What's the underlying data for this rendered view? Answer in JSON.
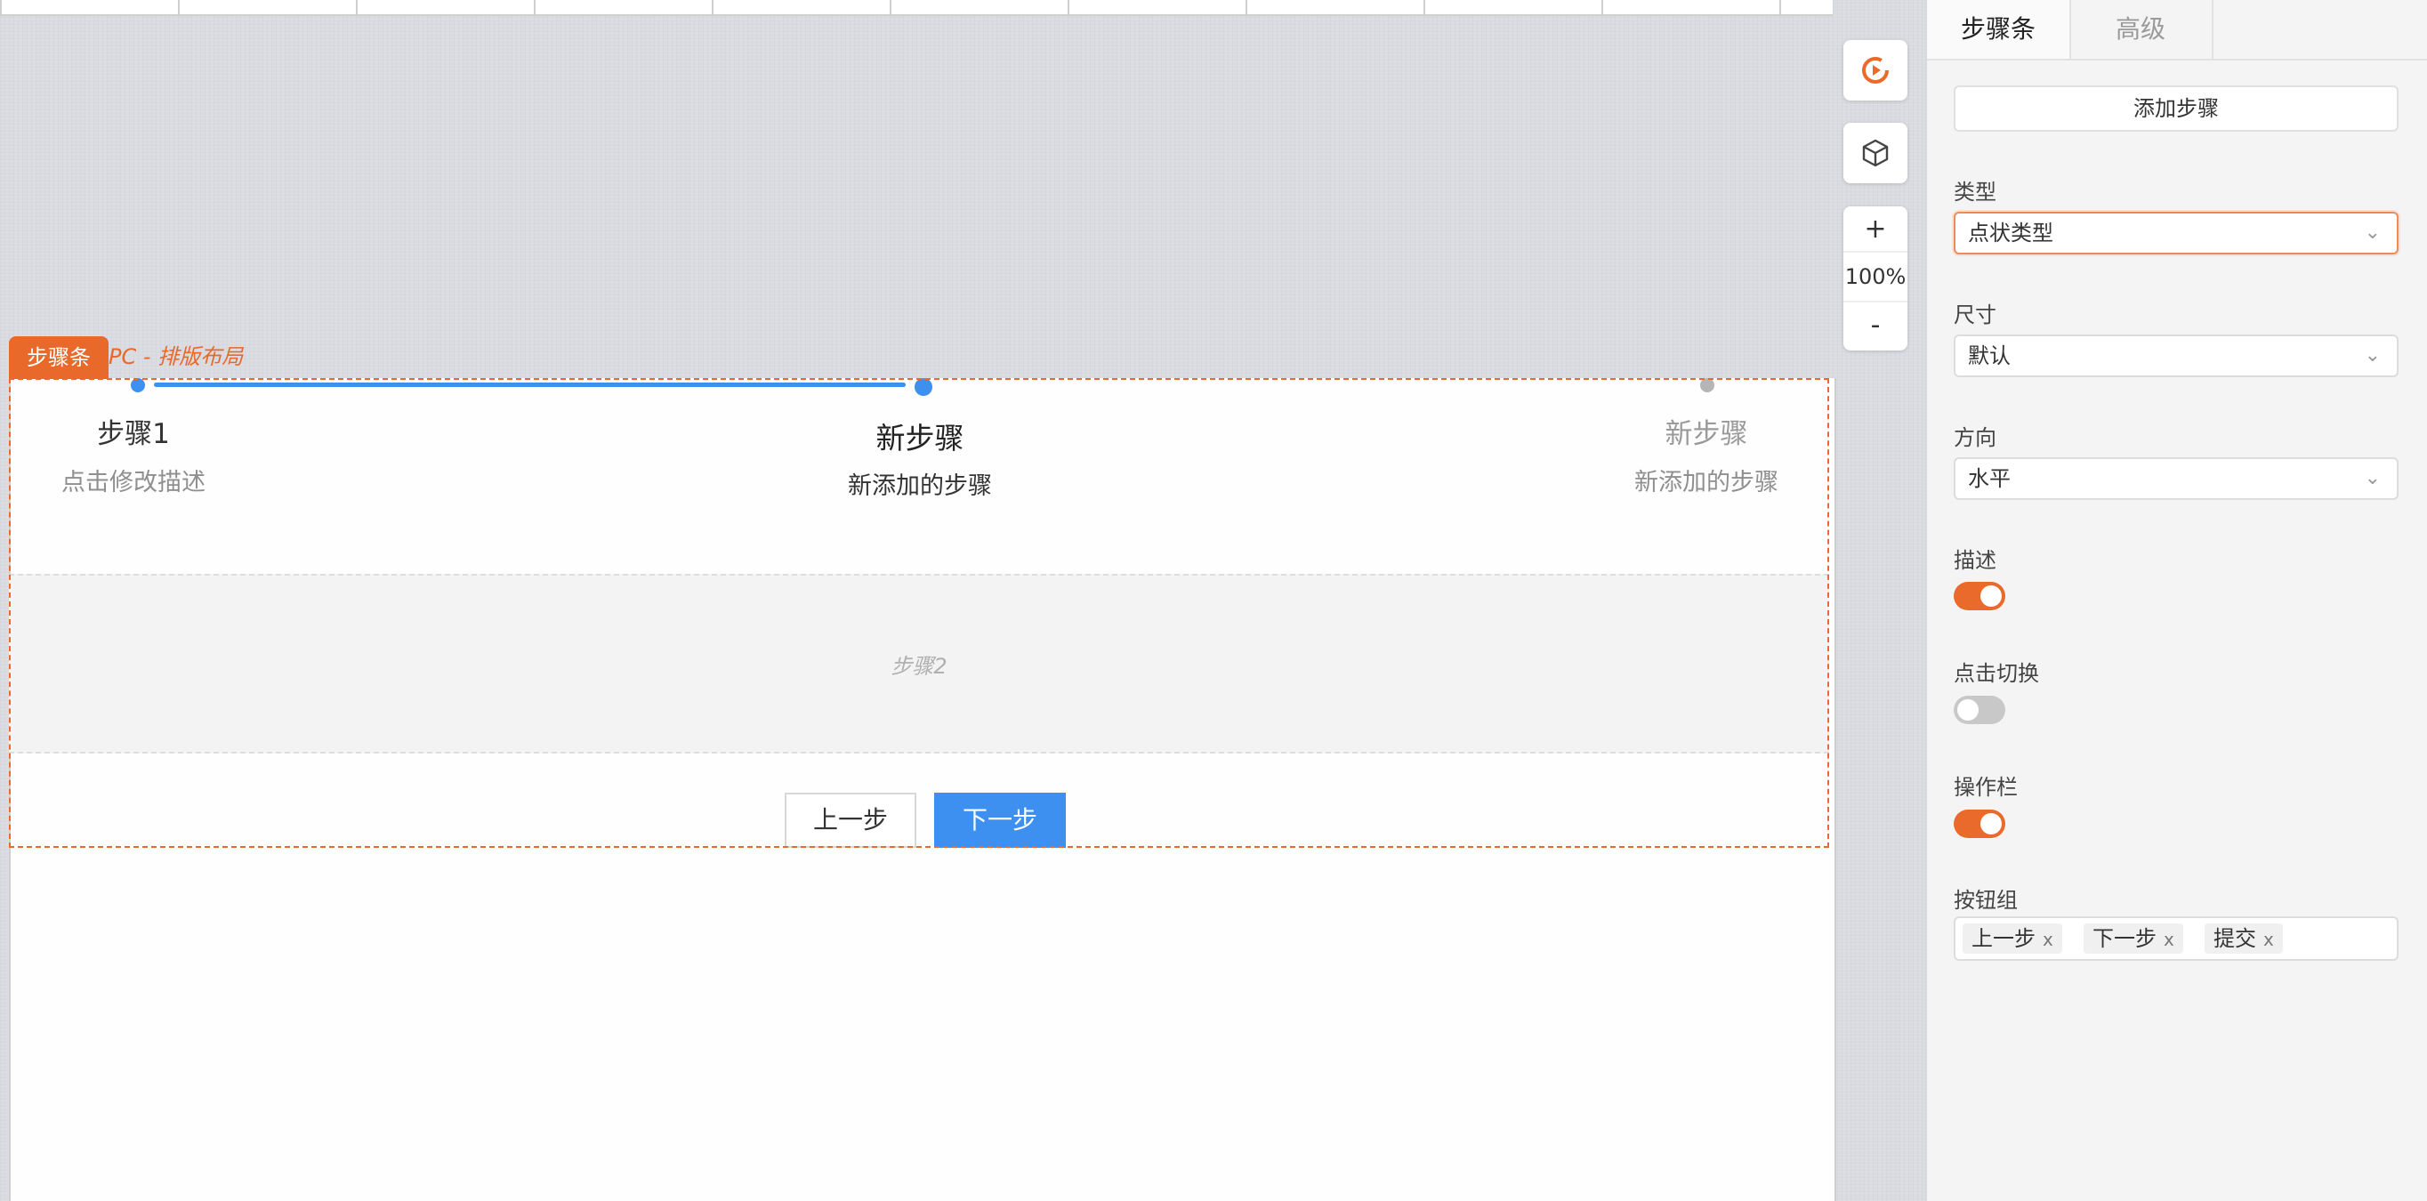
{
  "canvas": {
    "component_tag": "步骤条",
    "component_sub": "PC - 排版布局",
    "steps": [
      {
        "title": "步骤1",
        "desc": "点击修改描述"
      },
      {
        "title": "新步骤",
        "desc": "新添加的步骤"
      },
      {
        "title": "新步骤",
        "desc": "新添加的步骤"
      }
    ],
    "content_label": "步骤2",
    "prev_button": "上一步",
    "next_button": "下一步",
    "zoom": {
      "plus": "+",
      "value": "100%",
      "minus": "-"
    },
    "colors": {
      "accent": "#e8692a",
      "step_active": "#3d8ff0",
      "step_inactive": "#b5b5b5"
    }
  },
  "panel": {
    "tabs": [
      {
        "label": "步骤条"
      },
      {
        "label": "高级"
      }
    ],
    "add_step": "添加步骤",
    "fields": {
      "type": {
        "label": "类型",
        "value": "点状类型"
      },
      "size": {
        "label": "尺寸",
        "value": "默认"
      },
      "direction": {
        "label": "方向",
        "value": "水平"
      },
      "description": {
        "label": "描述",
        "on": true
      },
      "click_switch": {
        "label": "点击切换",
        "on": false
      },
      "action_bar": {
        "label": "操作栏",
        "on": true
      },
      "button_group": {
        "label": "按钮组",
        "tags": [
          "上一步",
          "下一步",
          "提交"
        ]
      }
    },
    "tag_remove": "x"
  }
}
